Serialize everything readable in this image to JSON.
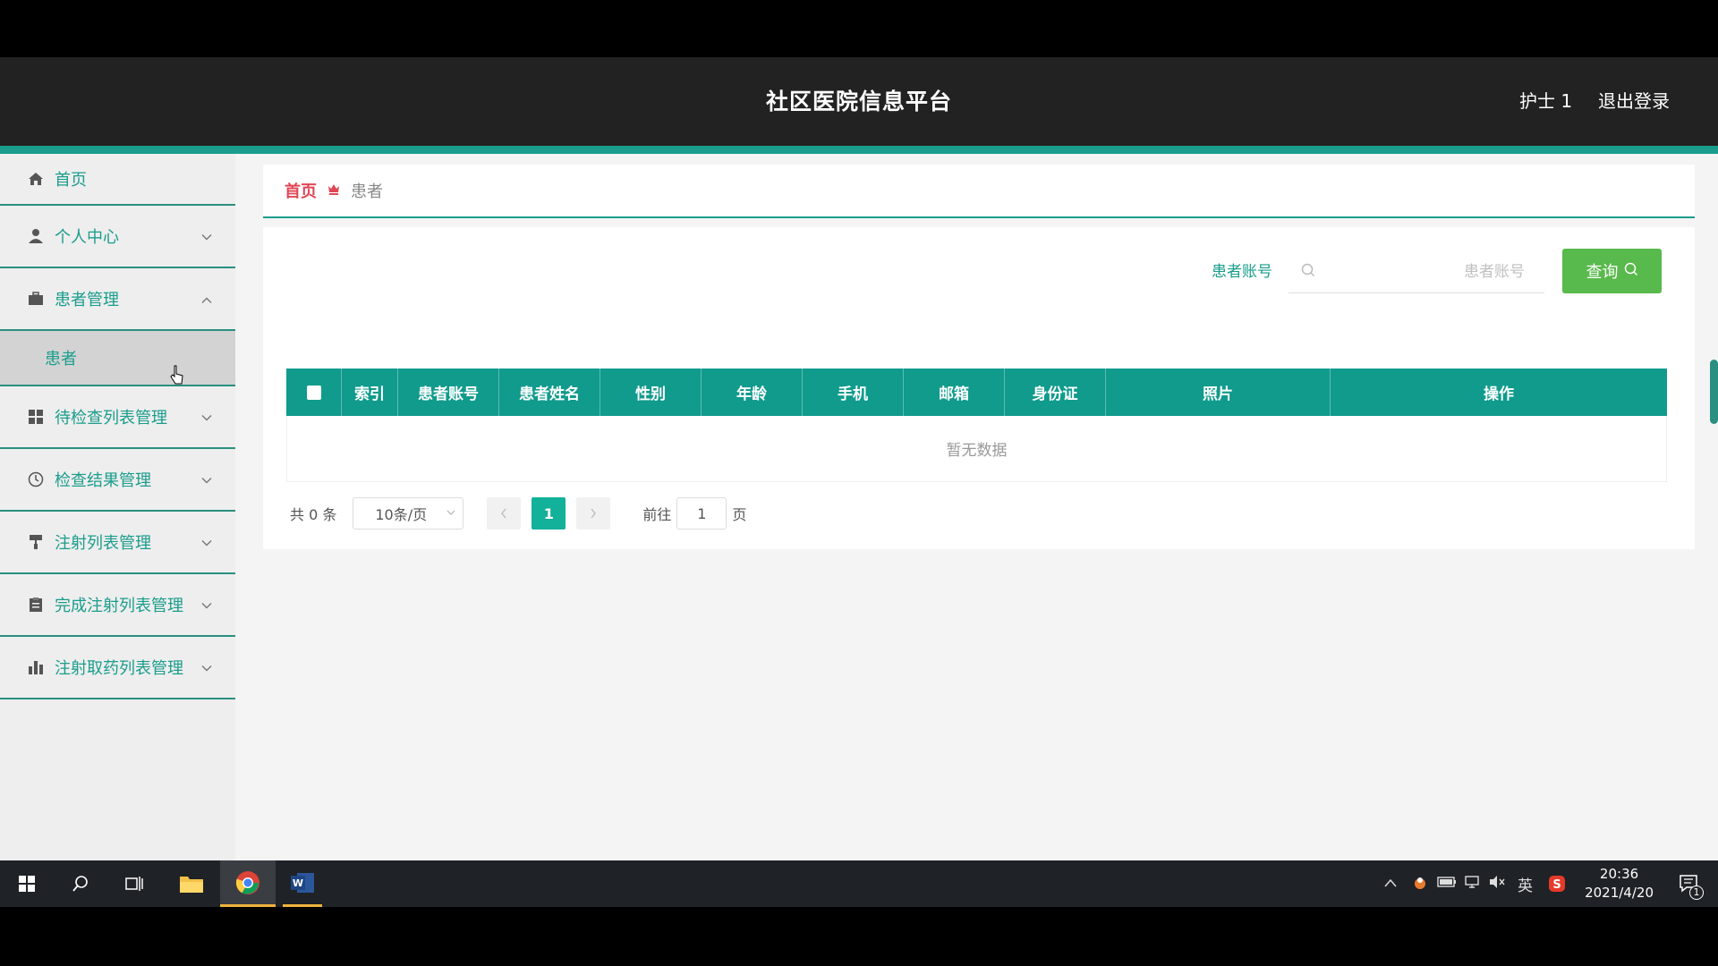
{
  "header": {
    "title": "社区医院信息平台",
    "user_name": "护士 1",
    "logout_label": "退出登录"
  },
  "sidebar": {
    "items": [
      {
        "label": "首页",
        "icon": "home-icon"
      },
      {
        "label": "个人中心",
        "icon": "user-icon"
      },
      {
        "label": "患者管理",
        "icon": "briefcase-icon",
        "expanded": true,
        "subitems": [
          {
            "label": "患者"
          }
        ]
      },
      {
        "label": "待检查列表管理",
        "icon": "grid-icon"
      },
      {
        "label": "检查结果管理",
        "icon": "clock-icon"
      },
      {
        "label": "注射列表管理",
        "icon": "paint-roller-icon"
      },
      {
        "label": "完成注射列表管理",
        "icon": "clipboard-icon"
      },
      {
        "label": "注射取药列表管理",
        "icon": "bar-chart-icon"
      }
    ]
  },
  "breadcrumb": {
    "home": "首页",
    "current": "患者"
  },
  "search": {
    "label": "患者账号",
    "placeholder": "患者账号",
    "button_label": "查询"
  },
  "table": {
    "columns": [
      "索引",
      "患者账号",
      "患者姓名",
      "性别",
      "年龄",
      "手机",
      "邮箱",
      "身份证",
      "照片",
      "操作"
    ],
    "empty_text": "暂无数据"
  },
  "pagination": {
    "total_text": "共 0 条",
    "page_size": "10条/页",
    "current_page": "1",
    "goto_label": "前往",
    "goto_value": "1",
    "page_suffix": "页"
  },
  "taskbar": {
    "time": "20:36",
    "date": "2021/4/20",
    "ime": "英",
    "notification_count": "1"
  },
  "colors": {
    "accent": "#1a9d8c",
    "header_bg": "#222222",
    "query_button": "#58b94c",
    "breadcrumb_home": "#e04756"
  }
}
